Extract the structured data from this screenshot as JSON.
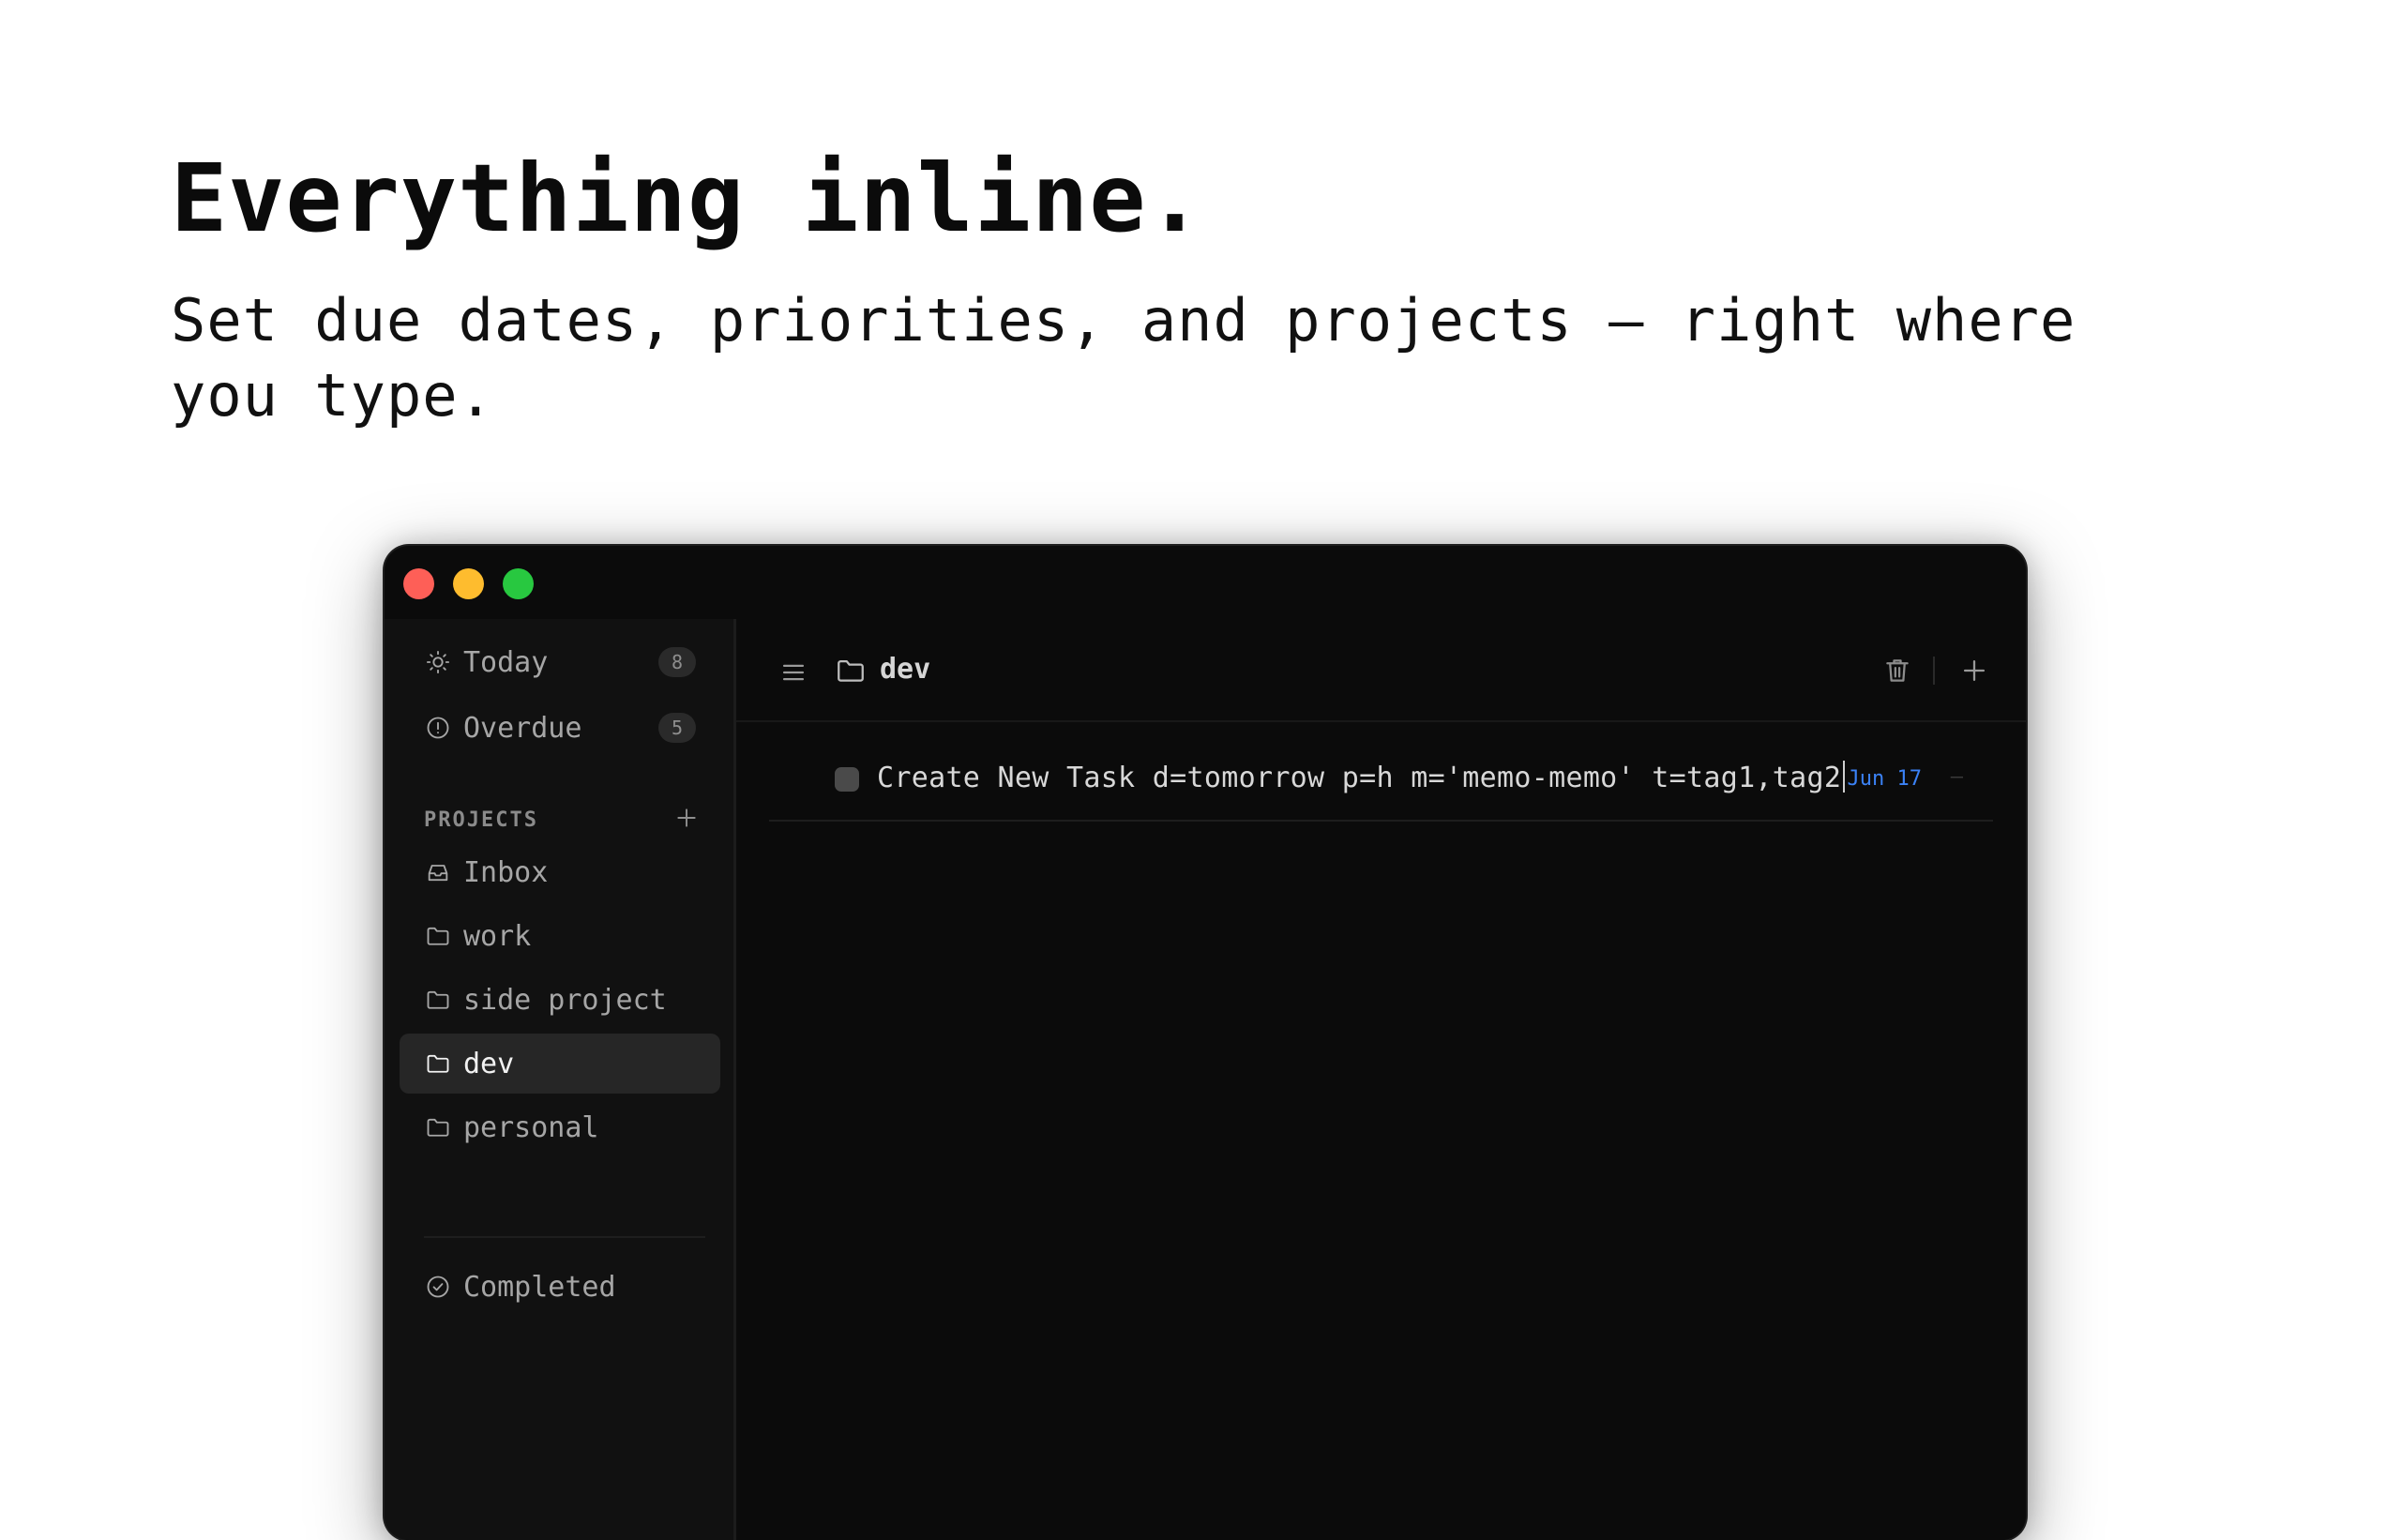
{
  "hero": {
    "title": "Everything inline.",
    "subtitle": "Set due dates, priorities, and projects — right where you type."
  },
  "window": {
    "traffic_lights": [
      "close",
      "minimize",
      "zoom"
    ]
  },
  "sidebar": {
    "smart_lists": [
      {
        "label": "Today",
        "count": "8",
        "icon": "sun-icon"
      },
      {
        "label": "Overdue",
        "count": "5",
        "icon": "alert-circle-icon"
      }
    ],
    "projects_header": "PROJECTS",
    "projects": [
      {
        "label": "Inbox",
        "icon": "inbox-icon"
      },
      {
        "label": "work",
        "icon": "folder-icon"
      },
      {
        "label": "side project",
        "icon": "folder-icon"
      },
      {
        "label": "dev",
        "icon": "folder-icon",
        "active": true
      },
      {
        "label": "personal",
        "icon": "folder-icon"
      }
    ],
    "completed": {
      "label": "Completed",
      "icon": "check-circle-icon"
    }
  },
  "main": {
    "project_title": "dev",
    "tasks": [
      {
        "text": "Create New Task d=tomorrow p=h m='memo-memo' t=tag1,tag2",
        "due": "Jun 17",
        "trailing": "—"
      }
    ]
  },
  "colors": {
    "accent_date": "#3b82f6",
    "window_bg": "#0b0b0b",
    "sidebar_bg": "#111111",
    "active_item_bg": "#262626"
  }
}
